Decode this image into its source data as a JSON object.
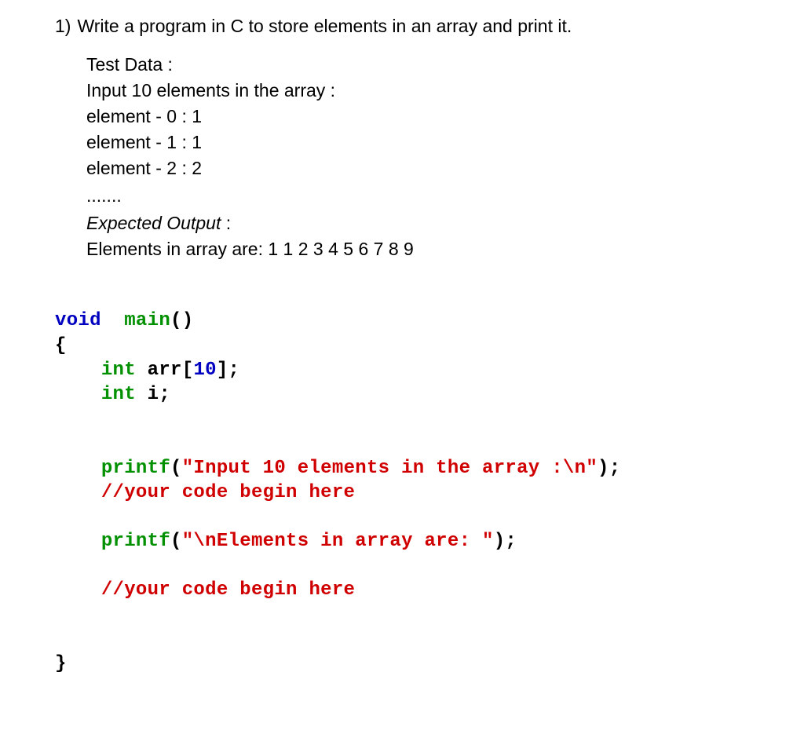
{
  "question": {
    "number": "1)",
    "title": "Write a program in C to store elements in an array and print it.",
    "test_data_label": "Test Data :",
    "input_label": "Input 10 elements in the array :",
    "elements": [
      "element - 0 : 1",
      "element - 1 : 1",
      "element - 2 : 2"
    ],
    "ellipsis": ".......",
    "expected_label": "Expected Output",
    "expected_colon": " :",
    "expected_text": "Elements in array are: 1 1 2 3 4 5 6 7 8 9"
  },
  "code": {
    "void": "void",
    "main": "main",
    "open_paren": "(",
    "close_paren": ")",
    "open_brace": "{",
    "close_brace": "}",
    "int1": "int",
    "arr_name": "arr",
    "open_bracket": "[",
    "ten": "10",
    "close_bracket": "]",
    "semi": ";",
    "int2": "int",
    "i_var": "i",
    "printf1": "printf",
    "str1": "\"Input 10 elements in the array :\\n\"",
    "comment1": "//your code begin here",
    "printf2": "printf",
    "str2": "\"\\nElements in array are: \"",
    "comment2": "//your code begin here"
  }
}
